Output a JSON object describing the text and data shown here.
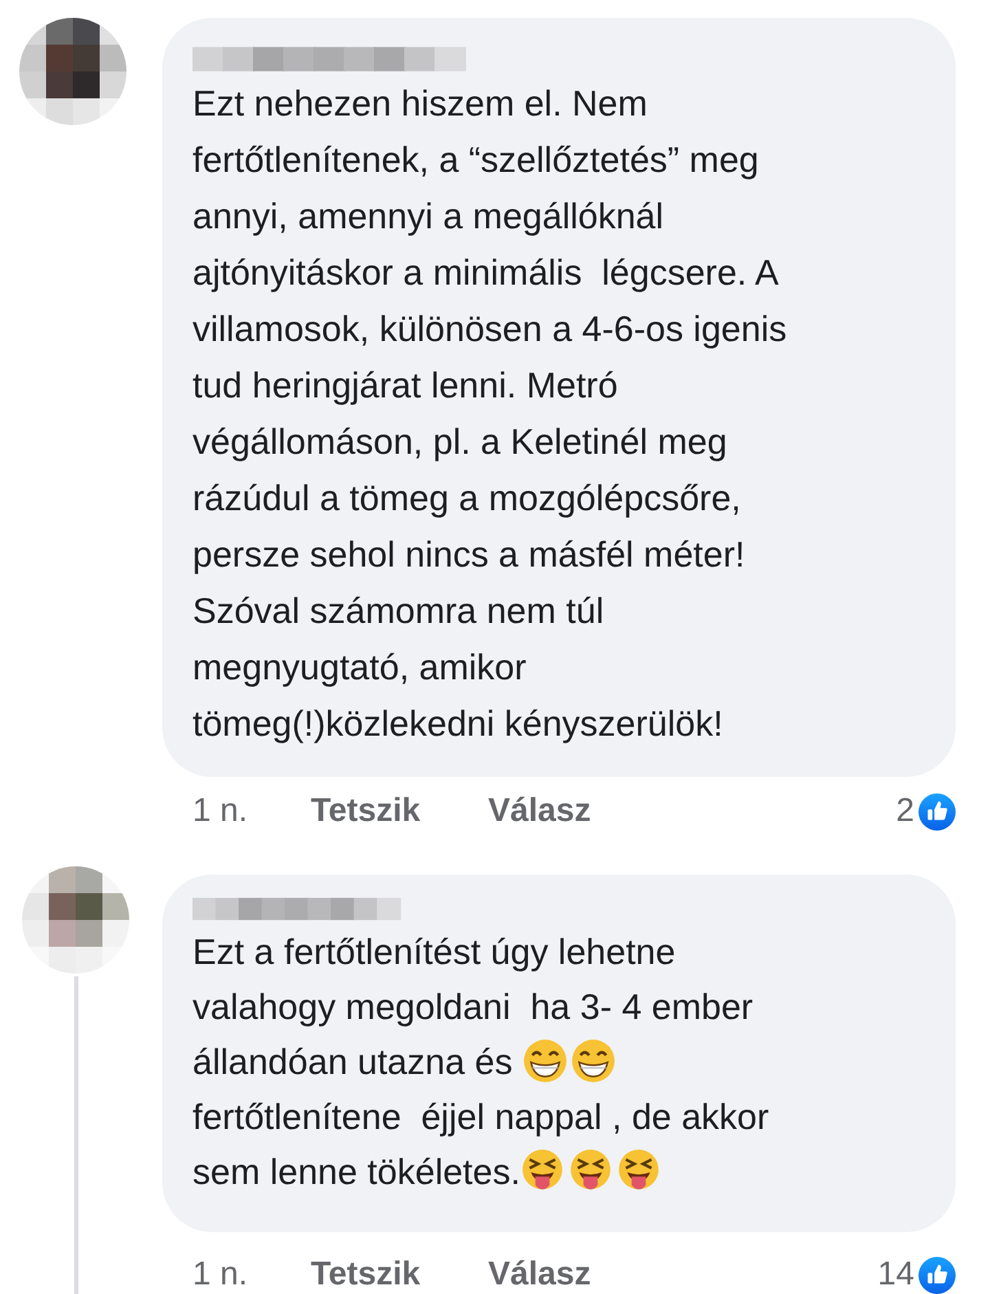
{
  "comments": [
    {
      "avatar": {
        "kind": "picture"
      },
      "name": {
        "kind": "picture"
      },
      "body": [
        [
          {
            "kind": "text",
            "text": "Ezt nehezen hiszem el. Nem"
          }
        ],
        [
          {
            "kind": "text",
            "text": "fertőtlenítenek, a “szellőztetés” meg"
          }
        ],
        [
          {
            "kind": "text",
            "text": "annyi, amennyi a megállóknál"
          }
        ],
        [
          {
            "kind": "text",
            "text": "ajtónyitáskor a minimális  légcsere. A"
          }
        ],
        [
          {
            "kind": "text",
            "text": "villamosok, különösen a 4-6-os igenis"
          }
        ],
        [
          {
            "kind": "text",
            "text": "tud heringjárat lenni. Metró"
          }
        ],
        [
          {
            "kind": "text",
            "text": "végállomáson, pl. a Keletinél meg"
          }
        ],
        [
          {
            "kind": "text",
            "text": "rázúdul a tömeg a mozgólépcsőre,"
          }
        ],
        [
          {
            "kind": "text",
            "text": "persze sehol nincs a másfél méter!"
          }
        ],
        [
          {
            "kind": "text",
            "text": "Szóval számomra nem túl"
          }
        ],
        [
          {
            "kind": "text",
            "text": "megnyugtató, amikor"
          }
        ],
        [
          {
            "kind": "text",
            "text": "tömeg(!)közlekedni kényszerülök!"
          }
        ]
      ],
      "time": "1 n.",
      "like": "Tetszik",
      "reply": "Válasz",
      "reactions": "2",
      "thread_line": false
    },
    {
      "avatar": {
        "kind": "picture"
      },
      "name": {
        "kind": "picture"
      },
      "body": [
        [
          {
            "kind": "text",
            "text": "Ezt a fertőtlenítést úgy lehetne"
          }
        ],
        [
          {
            "kind": "text",
            "text": "valahogy megoldani  ha 3- 4 ember"
          }
        ],
        [
          {
            "kind": "text",
            "text": "állandóan utazna és "
          },
          {
            "kind": "grin"
          },
          {
            "kind": "grin"
          }
        ],
        [
          {
            "kind": "text",
            "text": "fertőtlenítene  éjjel nappal , de akkor"
          }
        ],
        [
          {
            "kind": "text",
            "text": "sem lenne tökéletes."
          },
          {
            "kind": "tongue"
          },
          {
            "kind": "tongue"
          },
          {
            "kind": "tongue"
          }
        ]
      ],
      "time": "1 n.",
      "like": "Tetszik",
      "reply": "Válasz",
      "reactions": "14",
      "thread_line": true
    }
  ]
}
